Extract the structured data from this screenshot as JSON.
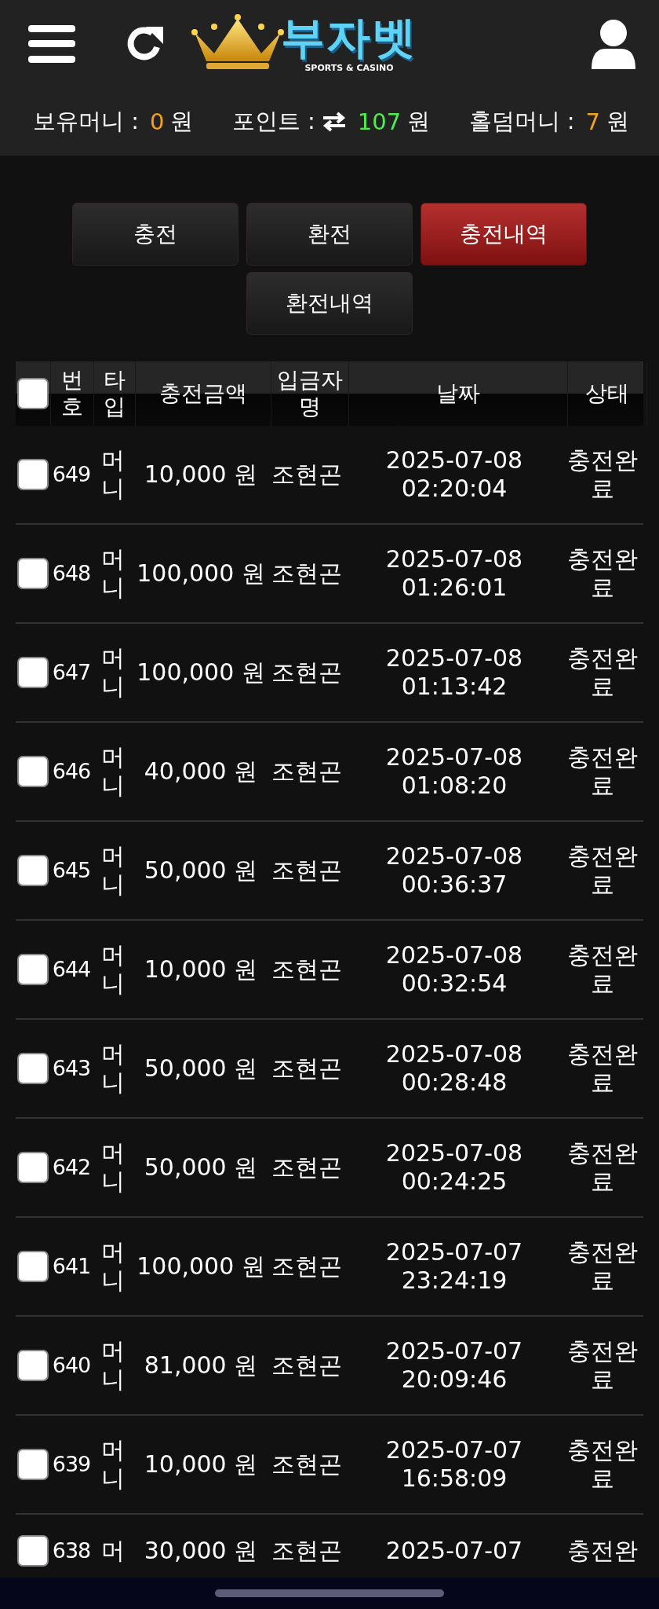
{
  "header": {
    "logo": {
      "title": "부자벳",
      "subtitle": "SPORTS & CASINO"
    }
  },
  "balances": [
    {
      "kind": "money",
      "label": "보유머니 :",
      "value": "0",
      "unit": "원",
      "color": "#f5a21b"
    },
    {
      "kind": "points",
      "label": "포인트 :",
      "value": "107",
      "unit": "원",
      "color": "#4cef4c"
    },
    {
      "kind": "money",
      "label": "홀덤머니 :",
      "value": "7",
      "unit": "원",
      "color": "#f5a21b"
    }
  ],
  "tabs": [
    {
      "label": "충전",
      "selected": false
    },
    {
      "label": "환전",
      "selected": false
    },
    {
      "label": "충전내역",
      "selected": true
    },
    {
      "label": "환전내역",
      "selected": false
    }
  ],
  "table": {
    "select_all": {
      "checked": false
    },
    "columns": [
      "번호",
      "타입",
      "충전금액",
      "입금자명",
      "날짜",
      "상태"
    ],
    "rows": [
      {
        "checked": false,
        "cells": [
          "649",
          "머니",
          "10,000 원",
          "조현곤",
          "2025-07-08 02:20:04",
          "충전완료"
        ]
      },
      {
        "checked": false,
        "cells": [
          "648",
          "머니",
          "100,000 원",
          "조현곤",
          "2025-07-08 01:26:01",
          "충전완료"
        ]
      },
      {
        "checked": false,
        "cells": [
          "647",
          "머니",
          "100,000 원",
          "조현곤",
          "2025-07-08 01:13:42",
          "충전완료"
        ]
      },
      {
        "checked": false,
        "cells": [
          "646",
          "머니",
          "40,000 원",
          "조현곤",
          "2025-07-08 01:08:20",
          "충전완료"
        ]
      },
      {
        "checked": false,
        "cells": [
          "645",
          "머니",
          "50,000 원",
          "조현곤",
          "2025-07-08 00:36:37",
          "충전완료"
        ]
      },
      {
        "checked": false,
        "cells": [
          "644",
          "머니",
          "10,000 원",
          "조현곤",
          "2025-07-08 00:32:54",
          "충전완료"
        ]
      },
      {
        "checked": false,
        "cells": [
          "643",
          "머니",
          "50,000 원",
          "조현곤",
          "2025-07-08 00:28:48",
          "충전완료"
        ]
      },
      {
        "checked": false,
        "cells": [
          "642",
          "머니",
          "50,000 원",
          "조현곤",
          "2025-07-08 00:24:25",
          "충전완료"
        ]
      },
      {
        "checked": false,
        "cells": [
          "641",
          "머니",
          "100,000 원",
          "조현곤",
          "2025-07-07 23:24:19",
          "충전완료"
        ]
      },
      {
        "checked": false,
        "cells": [
          "640",
          "머니",
          "81,000 원",
          "조현곤",
          "2025-07-07 20:09:46",
          "충전완료"
        ]
      },
      {
        "checked": false,
        "cells": [
          "639",
          "머니",
          "10,000 원",
          "조현곤",
          "2025-07-07 16:58:09",
          "충전완료"
        ]
      },
      {
        "checked": false,
        "cells": [
          "638",
          "머",
          "30,000 원",
          "조현곤",
          "2025-07-07",
          "충전완"
        ]
      }
    ]
  }
}
